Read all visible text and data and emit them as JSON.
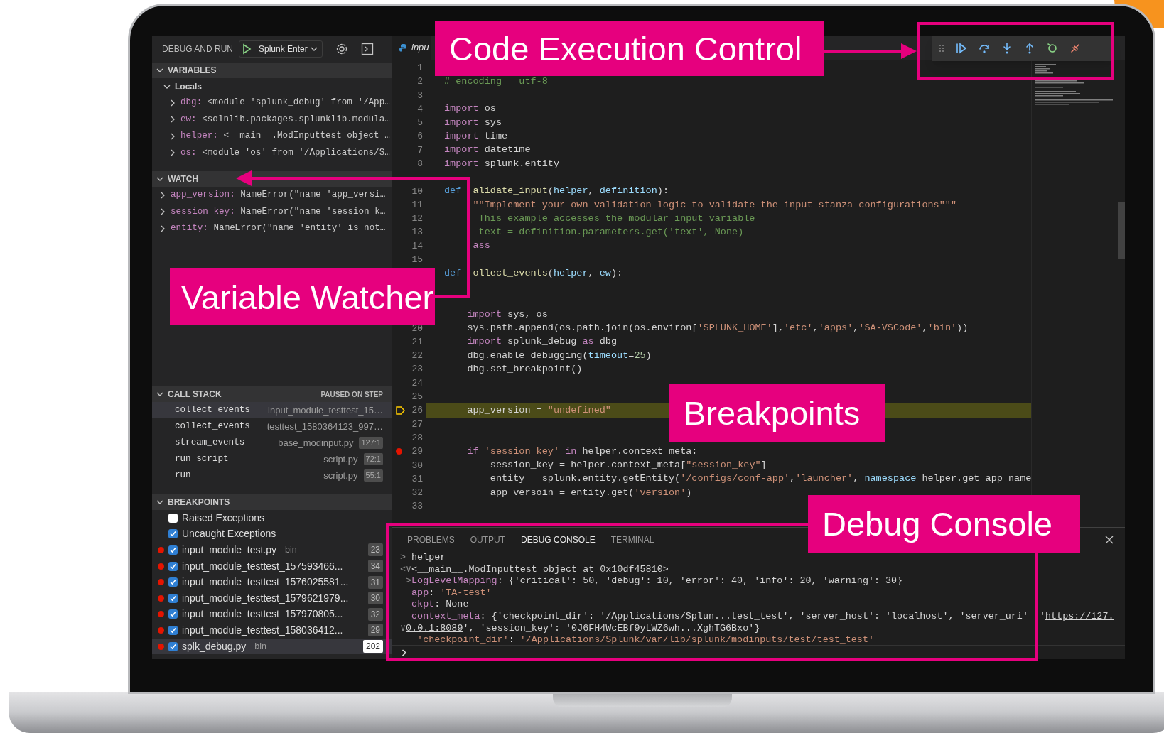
{
  "sidebar": {
    "title": "DEBUG AND RUN",
    "config": "Splunk Enter",
    "variables": {
      "title": "VARIABLES",
      "expanded": true,
      "scope": "Locals",
      "items": [
        {
          "name": "dbg:",
          "value": "<module 'splunk_debug' from '/App…"
        },
        {
          "name": "ew:",
          "value": "<solnlib.packages.splunklib.modula…"
        },
        {
          "name": "helper:",
          "value": "<__main__.ModInputtest object …"
        },
        {
          "name": "os:",
          "value": "<module 'os' from '/Applications/S…"
        }
      ]
    },
    "watch": {
      "title": "WATCH",
      "expanded": true,
      "items": [
        {
          "name": "app_version:",
          "value": "NameError(\"name 'app_versi…"
        },
        {
          "name": "session_key:",
          "value": "NameError(\"name 'session_k…"
        },
        {
          "name": "entity:",
          "value": "NameError(\"name 'entity' is not…"
        }
      ]
    },
    "call_stack": {
      "title": "CALL STACK",
      "status": "PAUSED ON STEP",
      "expanded": true,
      "frames": [
        {
          "name": "collect_events",
          "file": "input_module_testtest_15…",
          "selected": true
        },
        {
          "name": "collect_events",
          "file": "testtest_1580364123_997…",
          "selected": false
        },
        {
          "name": "stream_events",
          "file": "base_modinput.py",
          "line": "127:1",
          "selected": false
        },
        {
          "name": "run_script",
          "file": "script.py",
          "line": "72:1",
          "selected": false
        },
        {
          "name": "run",
          "file": "script.py",
          "line": "55:1",
          "selected": false
        }
      ]
    },
    "breakpoints": {
      "title": "BREAKPOINTS",
      "expanded": true,
      "items": [
        {
          "kind": "exception",
          "label": "Raised Exceptions",
          "checked": false,
          "selected": false
        },
        {
          "kind": "exception",
          "label": "Uncaught Exceptions",
          "checked": true,
          "selected": false
        },
        {
          "kind": "file",
          "label": "input_module_test.py",
          "path": "bin",
          "count": "23",
          "checked": true,
          "selected": false
        },
        {
          "kind": "file",
          "label": "input_module_testtest_157593466...",
          "count": "34",
          "checked": true,
          "selected": false
        },
        {
          "kind": "file",
          "label": "input_module_testtest_1576025581...",
          "count": "31",
          "checked": true,
          "selected": false
        },
        {
          "kind": "file",
          "label": "input_module_testtest_1579621979...",
          "count": "30",
          "checked": true,
          "selected": false
        },
        {
          "kind": "file",
          "label": "input_module_testtest_157970805...",
          "count": "32",
          "checked": true,
          "selected": false
        },
        {
          "kind": "file",
          "label": "input_module_testtest_158036412...",
          "count": "29",
          "checked": true,
          "selected": false
        },
        {
          "kind": "file",
          "label": "splk_debug.py",
          "path": "bin",
          "count": "202",
          "checked": true,
          "selected": true
        }
      ]
    }
  },
  "editor": {
    "tab": "inpu",
    "lines": [
      {
        "kind": "code",
        "n": "1"
      },
      {
        "kind": "code",
        "n": "2",
        "s": [
          {
            "kind": "comment",
            "text": "# encoding = utf-8"
          }
        ]
      },
      {
        "kind": "code",
        "n": "3"
      },
      {
        "kind": "code",
        "n": "4",
        "s": [
          {
            "kind": "keyword",
            "text": "import"
          },
          {
            "kind": "plain",
            "text": " os"
          }
        ]
      },
      {
        "kind": "code",
        "n": "5",
        "s": [
          {
            "kind": "keyword",
            "text": "import"
          },
          {
            "kind": "plain",
            "text": " sys"
          }
        ]
      },
      {
        "kind": "code",
        "n": "6",
        "s": [
          {
            "kind": "keyword",
            "text": "import"
          },
          {
            "kind": "plain",
            "text": " time"
          }
        ]
      },
      {
        "kind": "code",
        "n": "7",
        "s": [
          {
            "kind": "keyword",
            "text": "import"
          },
          {
            "kind": "plain",
            "text": " datetime"
          }
        ]
      },
      {
        "kind": "code",
        "n": "8",
        "s": [
          {
            "kind": "keyword",
            "text": "import"
          },
          {
            "kind": "plain",
            "text": " splunk.entity"
          }
        ]
      },
      {
        "kind": "blank"
      },
      {
        "kind": "code",
        "n": "10",
        "s": [
          {
            "kind": "def",
            "text": "def"
          },
          {
            "kind": "function",
            "text": "  alidate_input"
          },
          {
            "kind": "plain",
            "text": "("
          },
          {
            "kind": "param",
            "text": "helper"
          },
          {
            "kind": "plain",
            "text": ", "
          },
          {
            "kind": "param",
            "text": "definition"
          },
          {
            "kind": "plain",
            "text": "):"
          }
        ]
      },
      {
        "kind": "code",
        "n": "11",
        "s": [
          {
            "kind": "string",
            "text": "     \"\"Implement your own validation logic to validate the input stanza configurations\"\"\""
          }
        ]
      },
      {
        "kind": "code",
        "n": "12",
        "s": [
          {
            "kind": "comment",
            "text": "      This example accesses the modular input variable"
          }
        ]
      },
      {
        "kind": "code",
        "n": "13",
        "s": [
          {
            "kind": "comment",
            "text": "      text = definition.parameters.get('text', None)"
          }
        ]
      },
      {
        "kind": "code",
        "n": "14",
        "s": [
          {
            "kind": "keyword",
            "text": "     ass"
          }
        ]
      },
      {
        "kind": "code",
        "n": "15"
      },
      {
        "kind": "code",
        "s": [
          {
            "kind": "def",
            "text": "def"
          },
          {
            "kind": "function",
            "text": "  ollect_events"
          },
          {
            "kind": "plain",
            "text": "("
          },
          {
            "kind": "param",
            "text": "helper"
          },
          {
            "kind": "plain",
            "text": ", "
          },
          {
            "kind": "param",
            "text": "ew"
          },
          {
            "kind": "plain",
            "text": "):"
          }
        ]
      },
      {
        "kind": "blank"
      },
      {
        "kind": "blank"
      },
      {
        "kind": "code",
        "s": [
          {
            "kind": "keyword",
            "text": "    import"
          },
          {
            "kind": "plain",
            "text": " sys, os"
          }
        ]
      },
      {
        "kind": "code",
        "n": "20",
        "s": [
          {
            "kind": "plain",
            "text": "    sys.path.append(os.path.join(os.environ["
          },
          {
            "kind": "string",
            "text": "'SPLUNK_HOME'"
          },
          {
            "kind": "plain",
            "text": "],"
          },
          {
            "kind": "string",
            "text": "'etc'"
          },
          {
            "kind": "plain",
            "text": ","
          },
          {
            "kind": "string",
            "text": "'apps'"
          },
          {
            "kind": "plain",
            "text": ","
          },
          {
            "kind": "string",
            "text": "'SA-VSCode'"
          },
          {
            "kind": "plain",
            "text": ","
          },
          {
            "kind": "string",
            "text": "'bin'"
          },
          {
            "kind": "plain",
            "text": "))"
          }
        ]
      },
      {
        "kind": "code",
        "n": "21",
        "s": [
          {
            "kind": "keyword",
            "text": "    import"
          },
          {
            "kind": "plain",
            "text": " splunk_debug "
          },
          {
            "kind": "keyword",
            "text": "as"
          },
          {
            "kind": "plain",
            "text": " dbg"
          }
        ]
      },
      {
        "kind": "code",
        "n": "22",
        "s": [
          {
            "kind": "plain",
            "text": "    dbg.enable_debugging("
          },
          {
            "kind": "param",
            "text": "timeout"
          },
          {
            "kind": "plain",
            "text": "="
          },
          {
            "kind": "number",
            "text": "25"
          },
          {
            "kind": "plain",
            "text": ")"
          }
        ]
      },
      {
        "kind": "code",
        "n": "23",
        "s": [
          {
            "kind": "plain",
            "text": "    dbg.set_breakpoint()"
          }
        ]
      },
      {
        "kind": "code",
        "n": "24"
      },
      {
        "kind": "code",
        "n": "25"
      },
      {
        "kind": "current",
        "n": "26",
        "s": [
          {
            "kind": "plain",
            "text": "    app_version = "
          },
          {
            "kind": "string",
            "text": "\"undefined\""
          }
        ]
      },
      {
        "kind": "code",
        "n": "27"
      },
      {
        "kind": "code",
        "n": "28"
      },
      {
        "kind": "breakpoint",
        "n": "29",
        "s": [
          {
            "kind": "keyword",
            "text": "    if"
          },
          {
            "kind": "string",
            "text": " 'session_key'"
          },
          {
            "kind": "keyword",
            "text": " in"
          },
          {
            "kind": "plain",
            "text": " helper.context_meta:"
          }
        ]
      },
      {
        "kind": "code",
        "n": "30",
        "s": [
          {
            "kind": "plain",
            "text": "        session_key = helper.context_meta["
          },
          {
            "kind": "string",
            "text": "\"session_key\""
          },
          {
            "kind": "plain",
            "text": "]"
          }
        ]
      },
      {
        "kind": "code",
        "n": "31",
        "s": [
          {
            "kind": "plain",
            "text": "        entity = splunk.entity.getEntity("
          },
          {
            "kind": "string",
            "text": "'/configs/conf-app'"
          },
          {
            "kind": "plain",
            "text": ","
          },
          {
            "kind": "string",
            "text": "'launcher'"
          },
          {
            "kind": "plain",
            "text": ", "
          },
          {
            "kind": "param",
            "text": "namespace"
          },
          {
            "kind": "plain",
            "text": "=helper.get_app_name"
          }
        ]
      },
      {
        "kind": "code",
        "n": "32",
        "s": [
          {
            "kind": "plain",
            "text": "        app_versoin = entity.get("
          },
          {
            "kind": "string",
            "text": "'version'"
          },
          {
            "kind": "plain",
            "text": ")"
          }
        ]
      },
      {
        "kind": "code",
        "n": "33"
      }
    ]
  },
  "panel": {
    "tabs": [
      {
        "label": "PROBLEMS",
        "selected": false
      },
      {
        "label": "OUTPUT",
        "selected": false
      },
      {
        "label": "DEBUG CONSOLE",
        "selected": true
      },
      {
        "label": "TERMINAL",
        "selected": false
      }
    ],
    "console": [
      [
        {
          "kind": "dim",
          "text": ">"
        },
        {
          "kind": "plain",
          "text": " helper"
        }
      ],
      [
        {
          "kind": "dim",
          "text": "<∨"
        },
        {
          "kind": "plain",
          "text": "<__main__.ModInputtest object at 0x10df45810>"
        }
      ],
      [
        {
          "kind": "dim",
          "text": " >"
        },
        {
          "kind": "key",
          "text": "LogLevelMapping"
        },
        {
          "kind": "plain",
          "text": ": {'critical': 50, 'debug': 10, 'error': 40, 'info': 20, 'warning': 30}"
        }
      ],
      [
        {
          "kind": "key",
          "text": "  app"
        },
        {
          "kind": "plain",
          "text": ": "
        },
        {
          "kind": "string",
          "text": "'TA-test'"
        }
      ],
      [
        {
          "kind": "key",
          "text": "  ckpt"
        },
        {
          "kind": "plain",
          "text": ": None"
        }
      ],
      [
        {
          "kind": "key",
          "text": "  context_meta"
        },
        {
          "kind": "plain",
          "text": ": {'checkpoint_dir': '/Applications/Splun...test_test', 'server_host': 'localhost', 'server_uri'  '"
        },
        {
          "kind": "link",
          "text": "https://127."
        }
      ],
      [
        {
          "kind": "dim",
          "text": "∨"
        },
        {
          "kind": "link",
          "text": "0.0.1:8089"
        },
        {
          "kind": "plain",
          "text": "', 'session_key': '0J6FH4WcEBf9yLWZ6wh...XghTG6Bxo'}"
        }
      ],
      [
        {
          "kind": "string",
          "text": "   'checkpoint_dir'"
        },
        {
          "kind": "plain",
          "text": ": "
        },
        {
          "kind": "string",
          "text": "'/Applications/Splunk/var/lib/splunk/modinputs/test/test_test'"
        }
      ]
    ]
  },
  "annotations": [
    {
      "kind": "toolbar",
      "label": "Code Execution Control"
    },
    {
      "kind": "watch",
      "label": "Variable Watcher"
    },
    {
      "kind": "plain",
      "label": "Breakpoints"
    },
    {
      "kind": "console",
      "label": "Debug Console"
    }
  ]
}
